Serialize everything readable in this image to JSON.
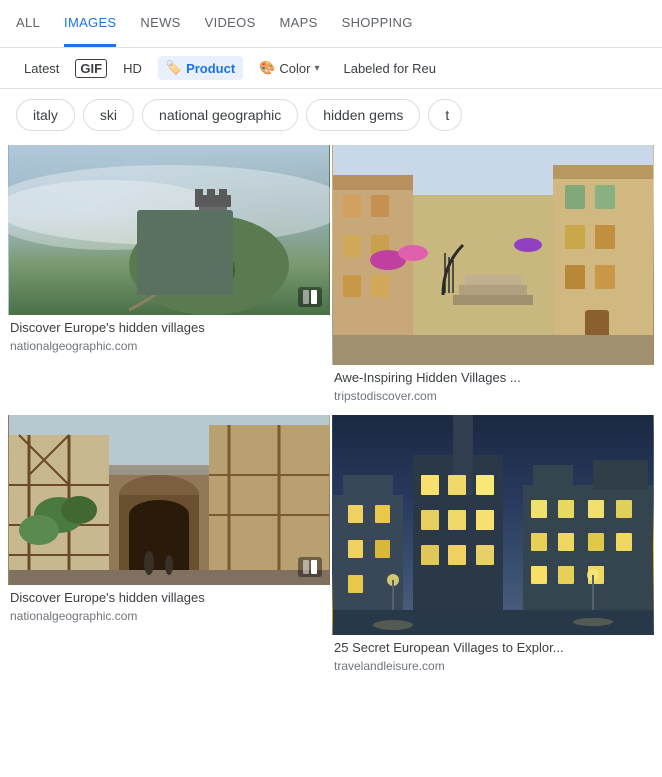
{
  "nav": {
    "tabs": [
      {
        "label": "ALL",
        "active": false
      },
      {
        "label": "IMAGES",
        "active": true
      },
      {
        "label": "NEWS",
        "active": false
      },
      {
        "label": "VIDEOS",
        "active": false
      },
      {
        "label": "MAPS",
        "active": false
      },
      {
        "label": "SHOPPING",
        "active": false
      }
    ]
  },
  "filters": {
    "items": [
      {
        "label": "Latest",
        "type": "text",
        "selected": false
      },
      {
        "label": "GIF",
        "type": "gif",
        "selected": false
      },
      {
        "label": "HD",
        "type": "text",
        "selected": false
      },
      {
        "label": "Product",
        "type": "icon-text",
        "icon": "🏷️",
        "selected": true
      },
      {
        "label": "Color",
        "type": "icon-dropdown",
        "icon": "🎨",
        "selected": false
      },
      {
        "label": "Labeled for Reu",
        "type": "text",
        "selected": false
      }
    ]
  },
  "chips": {
    "items": [
      {
        "label": "italy"
      },
      {
        "label": "ski"
      },
      {
        "label": "national geographic"
      },
      {
        "label": "hidden gems"
      },
      {
        "label": "t"
      }
    ]
  },
  "images": {
    "grid": [
      {
        "title": "Discover Europe's hidden villages",
        "source": "nationalgeographic.com",
        "has_carousel": true,
        "style": "misty"
      },
      {
        "title": "Awe-Inspiring Hidden Villages ...",
        "source": "tripstodiscover.com",
        "has_carousel": false,
        "style": "colorful"
      },
      {
        "title": "Discover Europe's hidden villages",
        "source": "nationalgeographic.com",
        "has_carousel": true,
        "style": "street"
      },
      {
        "title": "25 Secret European Villages to Explor...",
        "source": "travelandleisure.com",
        "has_carousel": false,
        "style": "night"
      }
    ]
  },
  "colors": {
    "accent_blue": "#1a73e8",
    "text_primary": "#3c4043",
    "text_secondary": "#70757a",
    "border": "#dadce0"
  }
}
